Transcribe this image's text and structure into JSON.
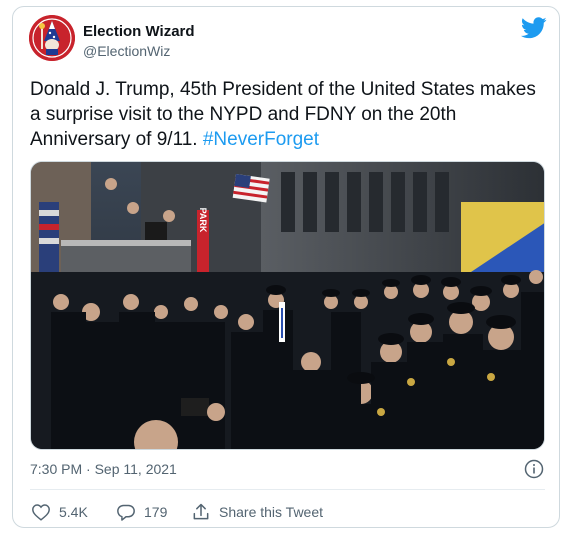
{
  "author": {
    "name": "Election Wizard",
    "handle": "@ElectionWiz",
    "avatar_icon": "wizard-logo-icon"
  },
  "tweet": {
    "text": "Donald J. Trump, 45th President of the United States makes a surprise visit to the NYPD and FDNY on the 20th Anniversary of 9/11.",
    "hashtag": "#NeverForget",
    "timestamp": "7:30 PM · Sep 11, 2021"
  },
  "photo": {
    "sign_text": "PARK"
  },
  "actions": {
    "like_count": "5.4K",
    "reply_count": "179",
    "share_label": "Share this Tweet"
  },
  "colors": {
    "brand": "#1d9bf0",
    "text": "#0f1419",
    "muted": "#536471"
  }
}
